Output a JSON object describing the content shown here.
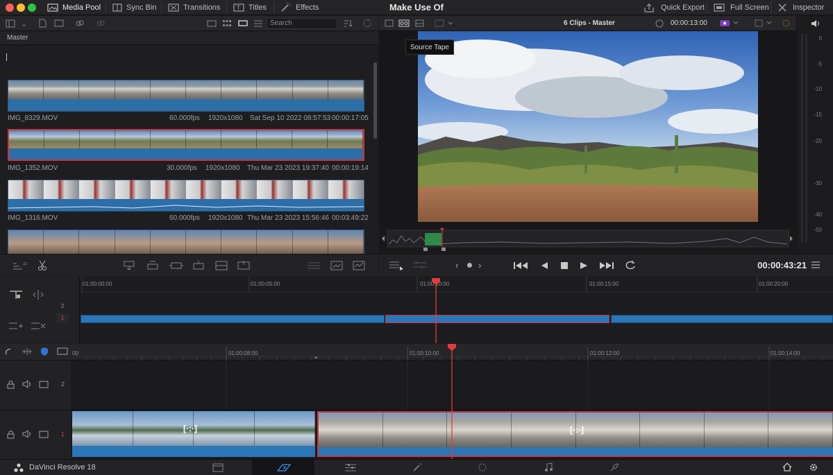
{
  "window": {
    "title": "Make Use Of"
  },
  "topbar": {
    "media_pool": "Media Pool",
    "sync_bin": "Sync Bin",
    "transitions": "Transitions",
    "titles": "Titles",
    "effects": "Effects",
    "quick_export": "Quick Export",
    "full_screen": "Full Screen",
    "inspector": "Inspector"
  },
  "media_pool": {
    "search_placeholder": "Search",
    "bin_name": "Master",
    "clips": [
      {
        "name": "IMG_8329.MOV",
        "fps": "60.000fps",
        "res": "1920x1080",
        "date": "Sat Sep 10 2022 08:57:53",
        "duration": "00:00:17:05",
        "selected": false
      },
      {
        "name": "IMG_1352.MOV",
        "fps": "30.000fps",
        "res": "1920x1080",
        "date": "Thu Mar 23 2023 19:37:40",
        "duration": "00:00:19:14",
        "selected": true
      },
      {
        "name": "IMG_1316.MOV",
        "fps": "60.000fps",
        "res": "1920x1080",
        "date": "Thu Mar 23 2023 15:56:46",
        "duration": "00:03:49:22",
        "selected": false
      }
    ]
  },
  "viewer": {
    "clip_info": "6 Clips - Master",
    "timecode_top": "00:00:13:00",
    "tooltip": "Source Tape"
  },
  "audio_meter": {
    "ticks": [
      "0",
      "-5",
      "-10",
      "-15",
      "-20",
      "-30",
      "-40",
      "-50"
    ]
  },
  "transport": {
    "timecode": "00:00:43:21"
  },
  "upper_timeline": {
    "ruler": [
      "01:00:00:00",
      "01:00:05:00",
      "01:00:10:00",
      "01:00:15:00",
      "01:00:20:00"
    ],
    "track_numbers": [
      "2",
      "1"
    ]
  },
  "lower_timeline": {
    "ruler": [
      "00",
      "01:00:08:00",
      "01:00:10:00",
      "01:00:12:00",
      "01:00:14:00"
    ],
    "track_numbers": [
      "2",
      "1"
    ]
  },
  "bottom": {
    "app_name": "DaVinci Resolve 18"
  },
  "colors": {
    "accent": "#2b76b6",
    "playhead": "#e23b3b",
    "selection": "#d2313a"
  }
}
